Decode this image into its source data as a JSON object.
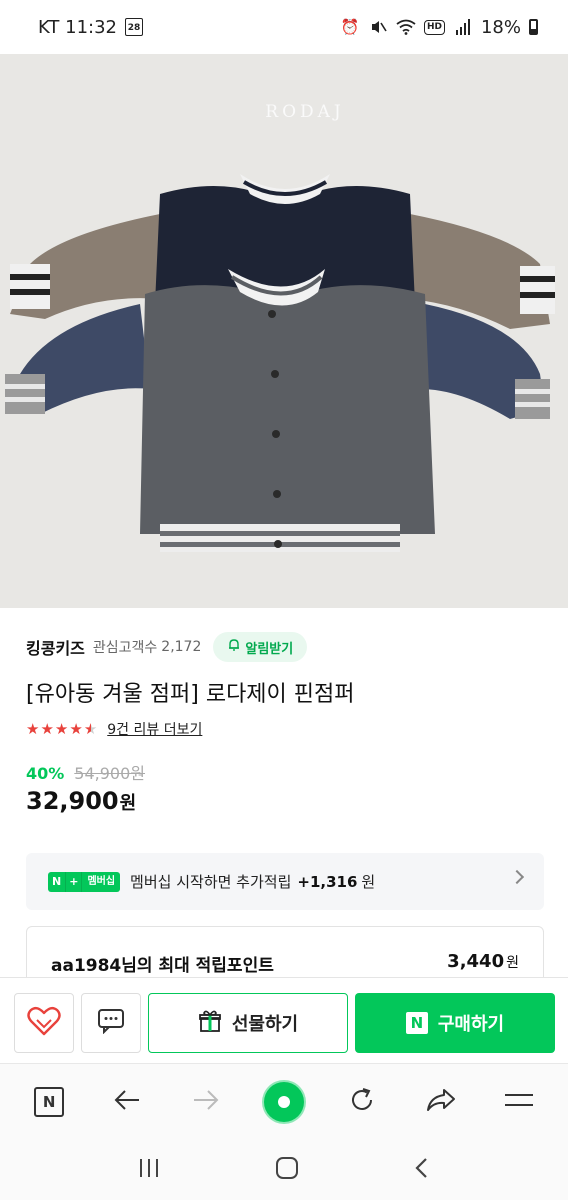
{
  "status_bar": {
    "carrier_time": "KT 11:32",
    "sim_badge": "28",
    "network_badge": "HD",
    "battery": "18%"
  },
  "product_image": {
    "brand_watermark": "RODAJ"
  },
  "store": {
    "name": "킹콩키즈",
    "follower_label": "관심고객수",
    "follower_count": "2,172",
    "alarm_label": "알림받기"
  },
  "product": {
    "title": "[유아동 겨울 점퍼] 로다제이 핀점퍼",
    "rating": 4.5,
    "review_link": "9건 리뷰 더보기",
    "discount": "40%",
    "original_price": "54,900원",
    "price": "32,900",
    "price_unit": "원"
  },
  "membership": {
    "badge_n": "N",
    "badge_plus": "+",
    "badge_label": "멤버십",
    "text": "멤버십 시작하면 추가적립",
    "points": "+1,316",
    "unit": "원"
  },
  "points_box": {
    "label": "aa1984님의 최대 적립포인트",
    "value": "3,440",
    "unit": "원"
  },
  "actions": {
    "gift_label": "선물하기",
    "buy_label": "구매하기",
    "buy_badge": "N"
  },
  "browser": {
    "home_badge": "N"
  },
  "colors": {
    "brand_green": "#03c75a",
    "star_red": "#e8423c"
  }
}
